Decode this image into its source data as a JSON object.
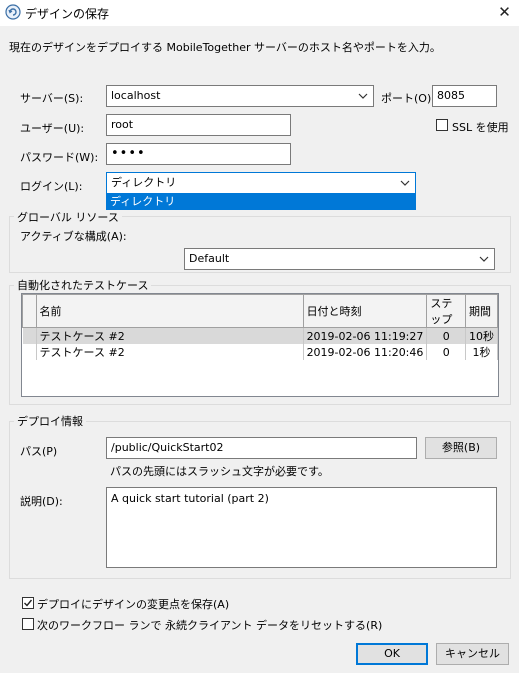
{
  "window": {
    "title": "デザインの保存",
    "close_glyph": "✕"
  },
  "intro_text": "現在のデザインをデプロイする MobileTogether サーバーのホスト名やポートを入力。",
  "server": {
    "label": "サーバー(S):",
    "value": "localhost",
    "port_label": "ポート(O):",
    "port_value": "8085"
  },
  "user": {
    "label": "ユーザー(U):",
    "value": "root",
    "ssl_label": "SSL を使用",
    "ssl_checked": false
  },
  "password": {
    "label": "パスワード(W):",
    "value": "••••"
  },
  "login": {
    "label": "ログイン(L):",
    "value": "ディレクトリ",
    "options": [
      "ディレクトリ"
    ]
  },
  "global_resources": {
    "caption": "グローバル リソース",
    "active_config_label": "アクティブな構成(A):",
    "active_config_value": "Default"
  },
  "test_cases": {
    "caption": "自動化されたテストケース",
    "columns": [
      "名前",
      "日付と時刻",
      "ステップ",
      "期間"
    ],
    "rows": [
      {
        "name": "テストケース #2",
        "datetime": "2019-02-06 11:19:27",
        "steps": "0",
        "duration": "10秒"
      },
      {
        "name": "テストケース #2",
        "datetime": "2019-02-06 11:20:46",
        "steps": "0",
        "duration": "1秒"
      }
    ]
  },
  "deploy_info": {
    "caption": "デプロイ情報",
    "path_label": "パス(P)",
    "path_value": "/public/QuickStart02",
    "browse_label": "参照(B)",
    "path_hint": "パスの先頭にはスラッシュ文字が必要です。",
    "description_label": "説明(D):",
    "description_value": "A quick start tutorial (part 2)"
  },
  "options": {
    "save_changes_label": "デプロイにデザインの変更点を保存(A)",
    "save_changes_checked": true,
    "reset_data_label": "次のワークフロー ランで 永続クライアント データをリセットする(R)",
    "reset_data_checked": false
  },
  "buttons": {
    "ok": "OK",
    "cancel": "キャンセル"
  },
  "colors": {
    "selection": "#0078d7",
    "row_selected": "#d9d9d9"
  }
}
